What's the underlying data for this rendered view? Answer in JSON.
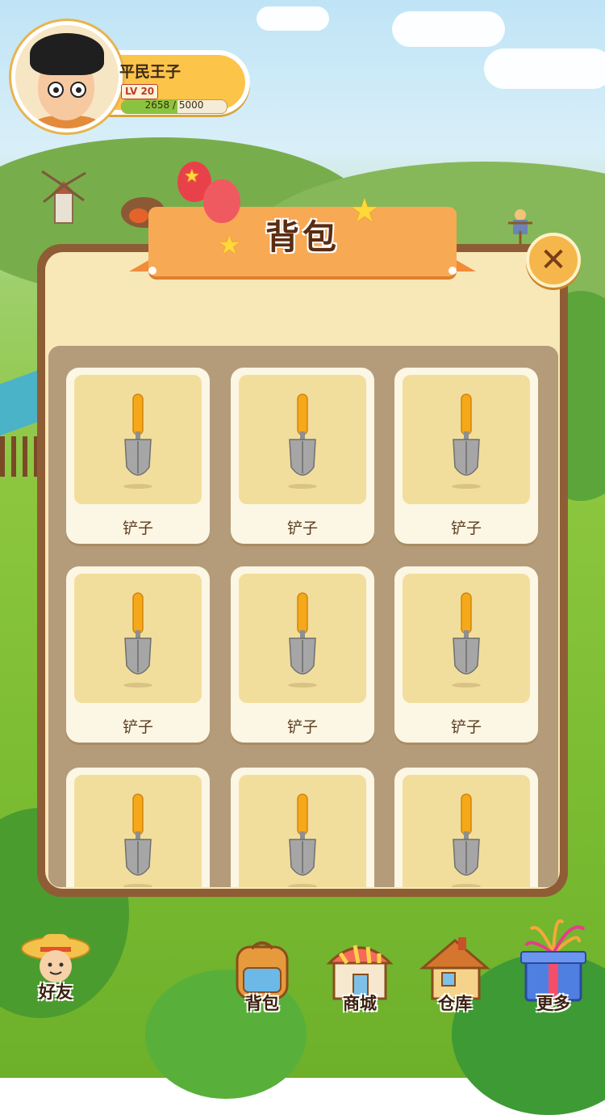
{
  "player": {
    "name": "平民王子",
    "level": "LV 20",
    "xp_current": 2658,
    "xp_max": 5000,
    "xp_text": "2658 / 5000"
  },
  "dialog": {
    "title": "背包",
    "close_icon": "close-icon",
    "items": [
      {
        "label": "铲子",
        "icon": "trowel-icon"
      },
      {
        "label": "铲子",
        "icon": "trowel-icon"
      },
      {
        "label": "铲子",
        "icon": "trowel-icon"
      },
      {
        "label": "铲子",
        "icon": "trowel-icon"
      },
      {
        "label": "铲子",
        "icon": "trowel-icon"
      },
      {
        "label": "铲子",
        "icon": "trowel-icon"
      },
      {
        "label": "",
        "icon": "trowel-icon"
      },
      {
        "label": "",
        "icon": "trowel-icon"
      },
      {
        "label": "",
        "icon": "trowel-icon"
      }
    ]
  },
  "nav": {
    "friends": "好友",
    "backpack": "背包",
    "shop": "商城",
    "warehouse": "仓库",
    "more": "更多"
  },
  "colors": {
    "ribbon": "#f8a954",
    "panel_border": "#8e5d35",
    "panel_bg": "#f8e8b8",
    "xp_fill": "#8ac43f"
  }
}
